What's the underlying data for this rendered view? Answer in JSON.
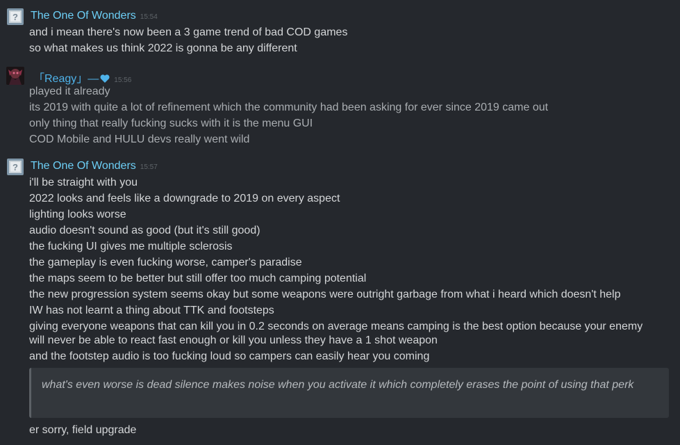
{
  "messages": [
    {
      "author": "The One Of Wonders",
      "time": "15:54",
      "lines": [
        "and i mean there's now been a 3 game trend of bad COD games",
        "so what makes us think 2022 is gonna be any different"
      ]
    },
    {
      "author": "「Reagy」—",
      "time": "15:56",
      "lines": [
        "played it already",
        "its 2019 with quite a lot of refinement which the community had been asking for ever since 2019 came out",
        "only thing that really fucking sucks with it is the menu GUI",
        "COD Mobile and HULU devs really went wild"
      ]
    },
    {
      "author": "The One Of Wonders",
      "time": "15:57",
      "lines": [
        "i'll be straight with you",
        "2022 looks and feels like a downgrade to 2019 on every aspect",
        "lighting looks worse",
        "audio doesn't sound as good (but it's still good)",
        "the fucking UI gives me multiple sclerosis",
        "the gameplay is even fucking worse, camper's paradise",
        "the maps seem to be better but still offer too much camping potential",
        "the new progression system seems okay but some weapons were outright garbage from what i heard which doesn't help",
        "IW has not learnt a thing about TTK and footsteps",
        "giving everyone weapons that can kill you in 0.2 seconds on average means camping is the best option because your enemy will never be able to react fast enough or kill you unless they have a 1 shot weapon",
        "and the footstep audio is too fucking loud so campers can easily hear you coming"
      ],
      "quote": "what's even worse is dead silence makes noise when you activate it which completely erases the point of using that perk",
      "after_quote": "er sorry, field upgrade"
    }
  ],
  "colors": {
    "background": "#25282d",
    "author_primary": "#6dcff6",
    "author_secondary": "#4fb3ea",
    "heart": "#4fb3ea",
    "message_text": "#d4d6d8",
    "dim_text": "#a9adb1",
    "timestamp": "#5f6469",
    "quote_bg": "#33373c"
  },
  "icons": {
    "avatar_1": "question-mark-avatar-icon",
    "avatar_2": "character-portrait-avatar-icon",
    "heart": "heart-icon"
  }
}
